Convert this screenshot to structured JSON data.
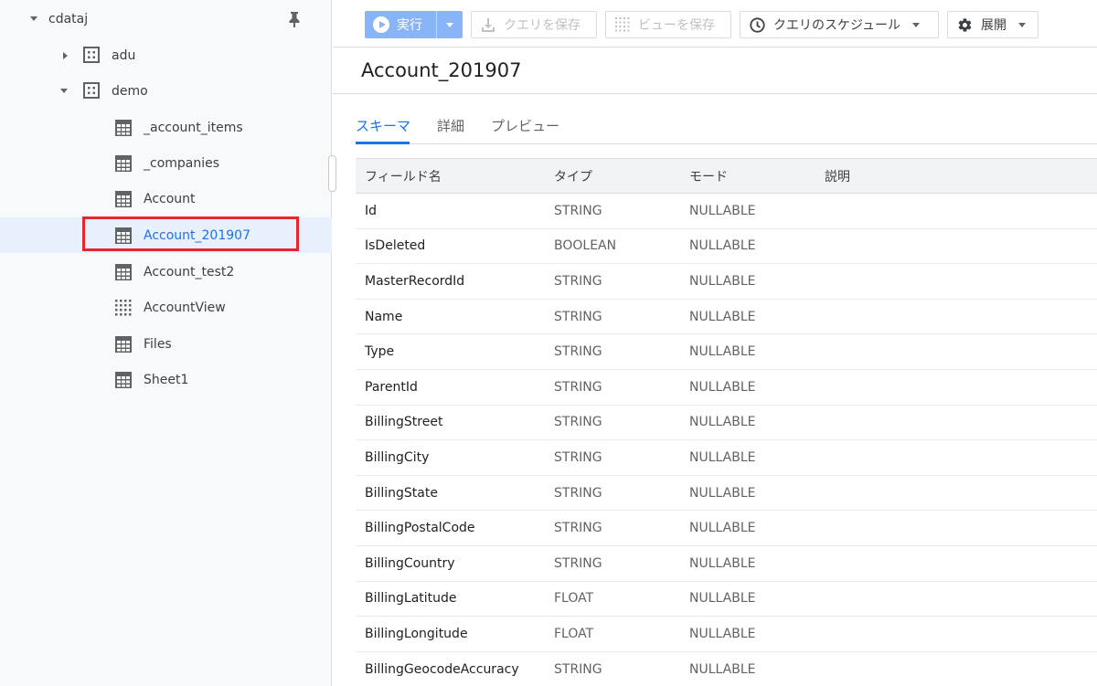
{
  "sidebar": {
    "project": {
      "label": "cdataj",
      "icon": "caret-down-icon"
    },
    "pin_icon": "pin-icon",
    "datasets": [
      {
        "label": "adu",
        "expanded": false,
        "icon": "dataset-icon"
      },
      {
        "label": "demo",
        "expanded": true,
        "icon": "dataset-icon"
      }
    ],
    "tables": [
      {
        "label": "_account_items",
        "icon": "table-icon"
      },
      {
        "label": "_companies",
        "icon": "table-icon"
      },
      {
        "label": "Account",
        "icon": "table-icon"
      },
      {
        "label": "Account_201907",
        "icon": "table-icon",
        "selected": true
      },
      {
        "label": "Account_test2",
        "icon": "table-icon"
      },
      {
        "label": "AccountView",
        "icon": "view-icon"
      },
      {
        "label": "Files",
        "icon": "table-icon"
      },
      {
        "label": "Sheet1",
        "icon": "table-icon"
      }
    ]
  },
  "toolbar": {
    "run_label": "実行",
    "save_query_label": "クエリを保存",
    "save_view_label": "ビューを保存",
    "schedule_label": "クエリのスケジュール",
    "export_label": "展開"
  },
  "main": {
    "title": "Account_201907",
    "tabs": [
      {
        "label": "スキーマ",
        "active": true
      },
      {
        "label": "詳細",
        "active": false
      },
      {
        "label": "プレビュー",
        "active": false
      }
    ],
    "schema": {
      "columns": [
        "フィールド名",
        "タイプ",
        "モード",
        "説明"
      ],
      "rows": [
        [
          "Id",
          "STRING",
          "NULLABLE",
          ""
        ],
        [
          "IsDeleted",
          "BOOLEAN",
          "NULLABLE",
          ""
        ],
        [
          "MasterRecordId",
          "STRING",
          "NULLABLE",
          ""
        ],
        [
          "Name",
          "STRING",
          "NULLABLE",
          ""
        ],
        [
          "Type",
          "STRING",
          "NULLABLE",
          ""
        ],
        [
          "ParentId",
          "STRING",
          "NULLABLE",
          ""
        ],
        [
          "BillingStreet",
          "STRING",
          "NULLABLE",
          ""
        ],
        [
          "BillingCity",
          "STRING",
          "NULLABLE",
          ""
        ],
        [
          "BillingState",
          "STRING",
          "NULLABLE",
          ""
        ],
        [
          "BillingPostalCode",
          "STRING",
          "NULLABLE",
          ""
        ],
        [
          "BillingCountry",
          "STRING",
          "NULLABLE",
          ""
        ],
        [
          "BillingLatitude",
          "FLOAT",
          "NULLABLE",
          ""
        ],
        [
          "BillingLongitude",
          "FLOAT",
          "NULLABLE",
          ""
        ],
        [
          "BillingGeocodeAccuracy",
          "STRING",
          "NULLABLE",
          ""
        ]
      ]
    }
  },
  "colors": {
    "accent": "#1a73e8",
    "run_button": "#8ab4f8",
    "highlight": "#e5262c",
    "selected_row": "#e8f0fe"
  }
}
